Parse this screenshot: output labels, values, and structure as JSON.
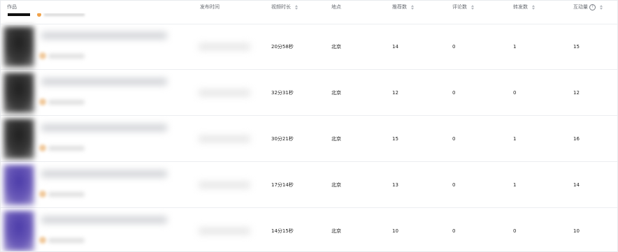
{
  "columns": {
    "work": "作品",
    "publish_time": "发布时间",
    "duration": "视频时长",
    "location": "地点",
    "recommend": "推荐数",
    "comments": "评论数",
    "shares": "转发数",
    "interactions": "互动量"
  },
  "rows": [
    {
      "thumb": "dark",
      "duration": "20分58秒",
      "location": "北京",
      "recommend": "14",
      "comments": "0",
      "shares": "1",
      "interactions": "15"
    },
    {
      "thumb": "dark",
      "duration": "32分31秒",
      "location": "北京",
      "recommend": "12",
      "comments": "0",
      "shares": "0",
      "interactions": "12"
    },
    {
      "thumb": "dark",
      "duration": "30分21秒",
      "location": "北京",
      "recommend": "15",
      "comments": "0",
      "shares": "1",
      "interactions": "16"
    },
    {
      "thumb": "purple",
      "duration": "17分14秒",
      "location": "北京",
      "recommend": "13",
      "comments": "0",
      "shares": "1",
      "interactions": "14"
    },
    {
      "thumb": "purple",
      "duration": "14分15秒",
      "location": "北京",
      "recommend": "10",
      "comments": "0",
      "shares": "0",
      "interactions": "10"
    }
  ]
}
